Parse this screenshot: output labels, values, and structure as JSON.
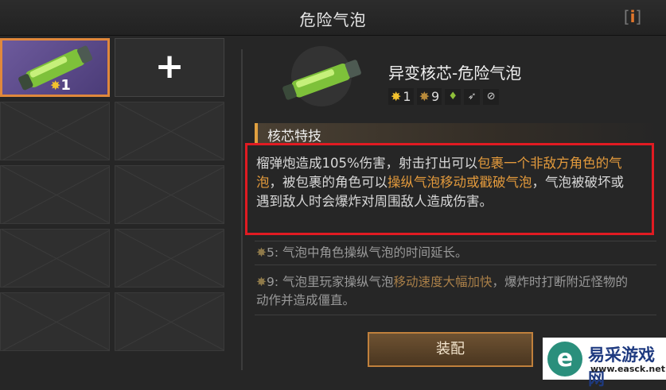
{
  "header": {
    "title": "危险气泡",
    "info_label": "i"
  },
  "slots": {
    "selected_star_count": "1",
    "add_label": "+"
  },
  "item": {
    "name": "异变核芯-危险气泡",
    "stats": {
      "star_a": "1",
      "star_b": "9"
    },
    "icons": [
      "leaf-element-icon",
      "weapon-rocket-icon",
      "cancel-circle-icon"
    ]
  },
  "section": {
    "title": "核芯特技"
  },
  "description": {
    "part1": "榴弹炮造成105%伤害，射击打出可以",
    "hl1": "包裹一个非敌方角色的气泡",
    "part2": "，被包裹的角色可以",
    "hl2": "操纵气泡移动或戳破气泡",
    "part3": "，气泡被破坏或遇到敌人时会爆炸对周围敌人造成伤害。"
  },
  "bonuses": [
    {
      "level": "5",
      "text": ": 气泡中角色操纵气泡的时间延长。"
    },
    {
      "level": "9",
      "text_a": ": 气泡里玩家操纵气泡",
      "hl": "移动速度大幅加快",
      "text_b": "，爆炸时打断附近怪物的动作并造成僵直。"
    }
  ],
  "actions": {
    "equip_label": "装配"
  },
  "watermark": {
    "logo": "e",
    "name": "易采游戏网",
    "url": "www.easck.net"
  },
  "colors": {
    "accent": "#e0883c",
    "highlight": "#e39a3c",
    "annotation_box": "#e11b22"
  }
}
